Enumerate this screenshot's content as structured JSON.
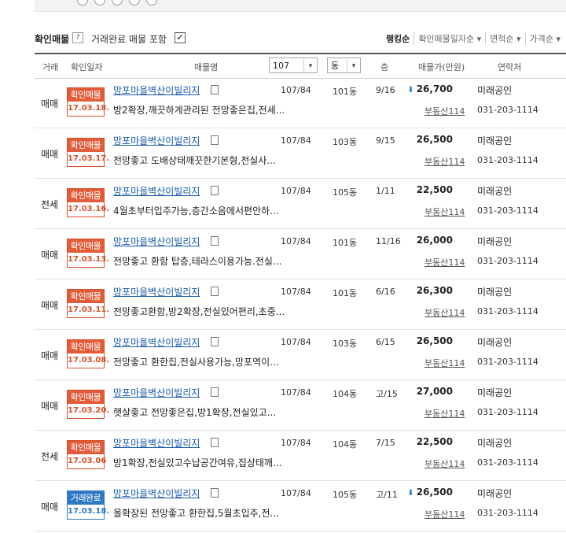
{
  "filter": {
    "confirmed_label": "확인매물",
    "help": "?",
    "include_completed_label": "거래완료 매물 포함",
    "include_completed_checked": true,
    "check_glyph": "✓",
    "sorts": [
      "랭킹순",
      "확인매물일자순",
      "면적순",
      "가격순"
    ]
  },
  "table": {
    "headers": {
      "deal": "거래",
      "confirm_date": "확인일자",
      "name": "매물명",
      "area_select": "107",
      "dong_select": "동",
      "floor": "층",
      "price": "매물가(만원)",
      "contact": "연락처"
    },
    "rows": [
      {
        "deal": "매매",
        "badge": "확인매물",
        "date": "17.03.18.",
        "badge_color": "red",
        "name": "망포마을벽산이빌리지",
        "desc": "방2확장,깨끗하게관리된 전망좋은집,전세...",
        "area": "107/84",
        "dong": "101동",
        "floor": "9/16",
        "price": "26,700",
        "price_down": true,
        "source": "부동산114",
        "agent": "미래공인",
        "phone": "031-203-1114"
      },
      {
        "deal": "매매",
        "badge": "확인매물",
        "date": "17.03.17.",
        "badge_color": "red",
        "name": "망포마을벽산이빌리지",
        "desc": "전망좋고 도배상태깨끗한기본형,전실사...",
        "area": "107/84",
        "dong": "103동",
        "floor": "9/15",
        "price": "26,500",
        "price_down": false,
        "source": "부동산114",
        "agent": "미래공인",
        "phone": "031-203-1114"
      },
      {
        "deal": "전세",
        "badge": "확인매물",
        "date": "17.03.16.",
        "badge_color": "red",
        "name": "망포마을벽산이빌리지",
        "desc": "4월초부터입주가능,층간소음에서편안하...",
        "area": "107/84",
        "dong": "105동",
        "floor": "1/11",
        "price": "22,500",
        "price_down": false,
        "source": "부동산114",
        "agent": "미래공인",
        "phone": "031-203-1114"
      },
      {
        "deal": "매매",
        "badge": "확인매물",
        "date": "17.03.13.",
        "badge_color": "red",
        "name": "망포마을벽산이빌리지",
        "desc": "전망좋고 환함 탑층,테라스이용가능.전실...",
        "area": "107/84",
        "dong": "101동",
        "floor": "11/16",
        "price": "26,000",
        "price_down": false,
        "source": "부동산114",
        "agent": "미래공인",
        "phone": "031-203-1114"
      },
      {
        "deal": "매매",
        "badge": "확인매물",
        "date": "17.03.11.",
        "badge_color": "red",
        "name": "망포마을벽산이빌리지",
        "desc": "전망좋고환함,방2확장,전실있어편리,초중...",
        "area": "107/84",
        "dong": "101동",
        "floor": "6/16",
        "price": "26,300",
        "price_down": false,
        "source": "부동산114",
        "agent": "미래공인",
        "phone": "031-203-1114"
      },
      {
        "deal": "매매",
        "badge": "확인매물",
        "date": "17.03.08.",
        "badge_color": "red",
        "name": "망포마을벽산이빌리지",
        "desc": "전망좋고 환한집,전실사용가능,망포역이...",
        "area": "107/84",
        "dong": "103동",
        "floor": "6/15",
        "price": "26,500",
        "price_down": false,
        "source": "부동산114",
        "agent": "미래공인",
        "phone": "031-203-1114"
      },
      {
        "deal": "매매",
        "badge": "확인매물",
        "date": "17.03.20.",
        "badge_color": "red",
        "name": "망포마을벽산이빌리지",
        "desc": "햇살좋고 전망좋은집,방1확장,전실있고...",
        "area": "107/84",
        "dong": "104동",
        "floor": "고/15",
        "price": "27,000",
        "price_down": false,
        "source": "부동산114",
        "agent": "미래공인",
        "phone": "031-203-1114"
      },
      {
        "deal": "전세",
        "badge": "확인매물",
        "date": "17.03.06",
        "badge_color": "red",
        "name": "망포마을벽산이빌리지",
        "desc": "방1확장,전실있고수납공간여유,집상태깨...",
        "area": "107/84",
        "dong": "104동",
        "floor": "7/15",
        "price": "22,500",
        "price_down": false,
        "source": "부동산114",
        "agent": "미래공인",
        "phone": "031-203-1114"
      },
      {
        "deal": "매매",
        "badge": "거래완료",
        "date": "17.03.18.",
        "badge_color": "blue",
        "name": "망포마을벽산이빌리지",
        "desc": "올확장된 전망좋고 환한집,5월초입주,전...",
        "area": "107/84",
        "dong": "105동",
        "floor": "고/11",
        "price": "26,500",
        "price_down": true,
        "source": "부동산114",
        "agent": "미래공인",
        "phone": "031-203-1114"
      }
    ]
  },
  "icons": {
    "price_down": "down-arrow-icon",
    "doc": "document-icon",
    "dropdown": "chevron-down-icon"
  },
  "colors": {
    "confirmed": "#e35c3a",
    "completed": "#2f78c4",
    "link": "#1a5ab0"
  }
}
